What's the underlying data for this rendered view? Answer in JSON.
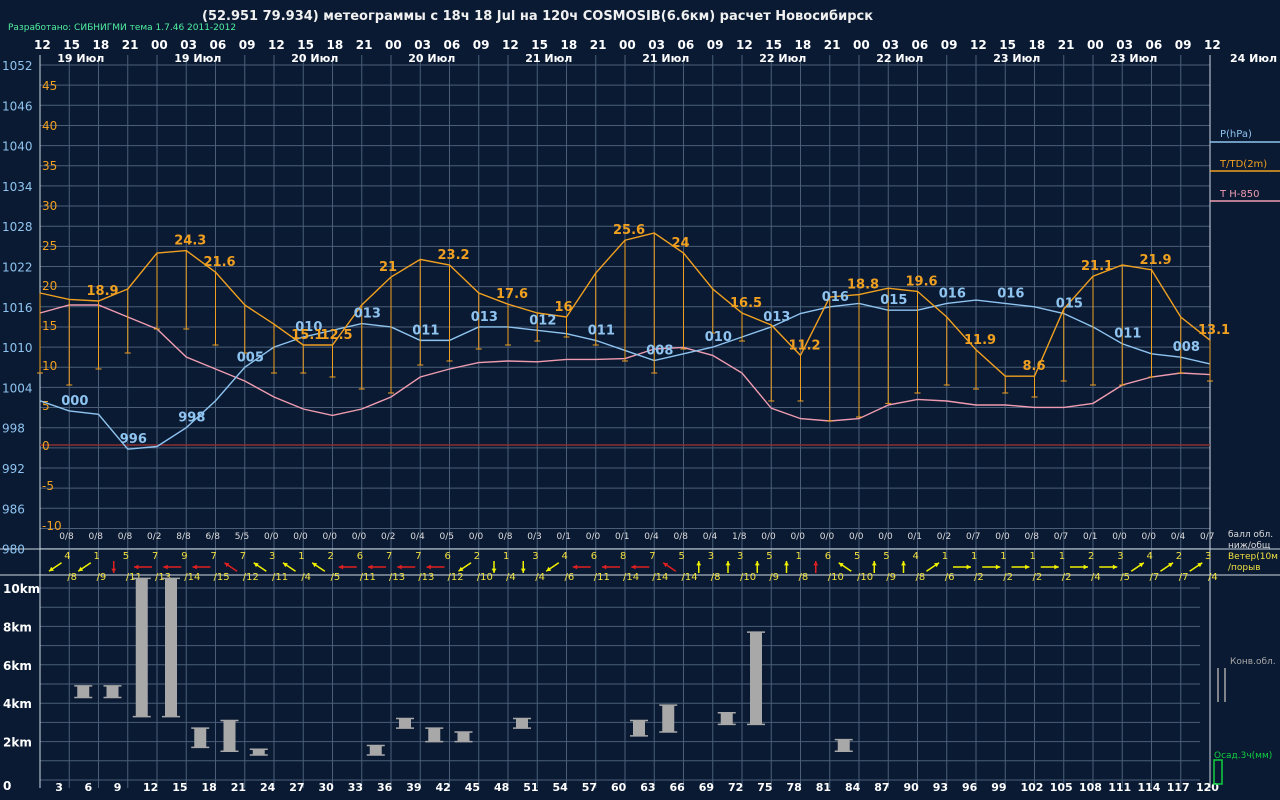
{
  "header": {
    "title": "(52.951 79.934) метеограммы с  18ч 18 Jul на 120ч COSMOSIB(6.6км) расчет Новосибирск",
    "credit": "Разработано: СИБНИГМИ тема 1.7.46 2011-2012"
  },
  "colors": {
    "bg": "#0a1a33",
    "grid": "#4a5e78",
    "white": "#ffffff",
    "pressure": "#8fc4f0",
    "temp": "#f0a020",
    "t850": "#ef9cb0",
    "zero": "#8a3030",
    "wind_yellow": "#f0f000",
    "wind_red": "#e02020",
    "cloud": "#a8a8a8",
    "precip": "#10d040",
    "label_yellow": "#f0e040"
  },
  "top_hours": [
    "12",
    "15",
    "18",
    "21",
    "00",
    "03",
    "06",
    "09",
    "12",
    "15",
    "18",
    "21",
    "00",
    "03",
    "06",
    "09",
    "12",
    "15",
    "18",
    "21",
    "00",
    "03",
    "06",
    "09",
    "12",
    "15",
    "18",
    "21",
    "00",
    "03",
    "06",
    "09",
    "12",
    "15",
    "18",
    "21",
    "00",
    "03",
    "06",
    "09",
    "12"
  ],
  "date_labels": [
    {
      "text": "19 Июл",
      "slot": 1
    },
    {
      "text": "19 Июл",
      "slot": 5
    },
    {
      "text": "20 Июл",
      "slot": 9
    },
    {
      "text": "20 Июл",
      "slot": 13
    },
    {
      "text": "21 Июл",
      "slot": 17
    },
    {
      "text": "21 Июл",
      "slot": 21
    },
    {
      "text": "22 Июл",
      "slot": 25
    },
    {
      "text": "22 Июл",
      "slot": 29
    },
    {
      "text": "23 Июл",
      "slot": 33
    },
    {
      "text": "23 Июл",
      "slot": 37
    },
    {
      "text": "24 Июл",
      "slot": 41
    }
  ],
  "pressure_ticks": [
    "1052",
    "1046",
    "1040",
    "1034",
    "1028",
    "1022",
    "1016",
    "1010",
    "1004",
    "998",
    "992",
    "986",
    "980"
  ],
  "temp_ticks": [
    "45",
    "40",
    "35",
    "30",
    "25",
    "20",
    "15",
    "10",
    "5",
    "0",
    "-5",
    "-10"
  ],
  "legend": {
    "pressure": "P(hPa)",
    "temp": "T/TD(2m)",
    "t850": "T H-850"
  },
  "cloud_label_1": "балл обл.",
  "cloud_label_2": "ниж/общ",
  "wind_label_1": "Ветер(10м",
  "wind_label_2": "/порыв",
  "alt_ticks": [
    "10km",
    "8km",
    "6km",
    "4km",
    "2km",
    "0"
  ],
  "bottom_hours": [
    "3",
    "6",
    "9",
    "12",
    "15",
    "18",
    "21",
    "24",
    "27",
    "30",
    "33",
    "36",
    "39",
    "42",
    "45",
    "48",
    "51",
    "54",
    "57",
    "60",
    "63",
    "66",
    "69",
    "72",
    "75",
    "78",
    "81",
    "84",
    "87",
    "90",
    "93",
    "96",
    "99",
    "102",
    "105",
    "108",
    "111",
    "114",
    "117",
    "120"
  ],
  "conv_label": "Конв.обл.",
  "precip_label": "Осад.3ч(мм)",
  "cloud_fractions": [
    "0/8",
    "0/8",
    "0/8",
    "0/2",
    "8/8",
    "6/8",
    "5/5",
    "0/0",
    "0/0",
    "0/0",
    "0/0",
    "0/2",
    "0/4",
    "0/5",
    "0/0",
    "0/8",
    "0/3",
    "0/1",
    "0/0",
    "0/1",
    "0/4",
    "0/8",
    "0/4",
    "1/8",
    "0/0",
    "0/0",
    "0/0",
    "0/0",
    "0/0",
    "0/1",
    "0/2",
    "0/7",
    "0/0",
    "0/8",
    "0/7",
    "0/1",
    "0/0",
    "0/0",
    "0/4",
    "0/7"
  ],
  "wind": [
    {
      "s": "4",
      "g": "/8",
      "d": "sw",
      "r": false
    },
    {
      "s": "1",
      "g": "/9",
      "d": "sw",
      "r": false
    },
    {
      "s": "5",
      "g": "/11",
      "d": "s",
      "r": true
    },
    {
      "s": "7",
      "g": "/13",
      "d": "w",
      "r": true
    },
    {
      "s": "9",
      "g": "/14",
      "d": "w",
      "r": true
    },
    {
      "s": "7",
      "g": "/15",
      "d": "w",
      "r": true
    },
    {
      "s": "7",
      "g": "/12",
      "d": "nw",
      "r": true
    },
    {
      "s": "3",
      "g": "/11",
      "d": "nw",
      "r": false
    },
    {
      "s": "1",
      "g": "/4",
      "d": "nw",
      "r": false
    },
    {
      "s": "2",
      "g": "/5",
      "d": "nw",
      "r": false
    },
    {
      "s": "6",
      "g": "/11",
      "d": "w",
      "r": true
    },
    {
      "s": "7",
      "g": "/13",
      "d": "w",
      "r": true
    },
    {
      "s": "7",
      "g": "/13",
      "d": "w",
      "r": true
    },
    {
      "s": "6",
      "g": "/12",
      "d": "w",
      "r": true
    },
    {
      "s": "2",
      "g": "/10",
      "d": "sw",
      "r": false
    },
    {
      "s": "1",
      "g": "/4",
      "d": "s",
      "r": false
    },
    {
      "s": "3",
      "g": "/4",
      "d": "s",
      "r": false
    },
    {
      "s": "4",
      "g": "/6",
      "d": "sw",
      "r": false
    },
    {
      "s": "6",
      "g": "/11",
      "d": "w",
      "r": true
    },
    {
      "s": "8",
      "g": "/14",
      "d": "w",
      "r": true
    },
    {
      "s": "7",
      "g": "/14",
      "d": "w",
      "r": true
    },
    {
      "s": "5",
      "g": "/14",
      "d": "nw",
      "r": true
    },
    {
      "s": "3",
      "g": "/8",
      "d": "n",
      "r": false
    },
    {
      "s": "3",
      "g": "/10",
      "d": "n",
      "r": false
    },
    {
      "s": "5",
      "g": "/9",
      "d": "n",
      "r": false
    },
    {
      "s": "1",
      "g": "/8",
      "d": "n",
      "r": false
    },
    {
      "s": "6",
      "g": "/10",
      "d": "n",
      "r": true
    },
    {
      "s": "5",
      "g": "/10",
      "d": "nw",
      "r": false
    },
    {
      "s": "5",
      "g": "/9",
      "d": "n",
      "r": false
    },
    {
      "s": "4",
      "g": "/8",
      "d": "n",
      "r": false
    },
    {
      "s": "1",
      "g": "/6",
      "d": "ne",
      "r": false
    },
    {
      "s": "1",
      "g": "/2",
      "d": "e",
      "r": false
    },
    {
      "s": "1",
      "g": "/2",
      "d": "e",
      "r": false
    },
    {
      "s": "1",
      "g": "/2",
      "d": "e",
      "r": false
    },
    {
      "s": "1",
      "g": "/2",
      "d": "e",
      "r": false
    },
    {
      "s": "2",
      "g": "/4",
      "d": "e",
      "r": false
    },
    {
      "s": "3",
      "g": "/5",
      "d": "e",
      "r": false
    },
    {
      "s": "4",
      "g": "/7",
      "d": "ne",
      "r": false
    },
    {
      "s": "2",
      "g": "/7",
      "d": "ne",
      "r": false
    },
    {
      "s": "3",
      "g": "/4",
      "d": "ne",
      "r": false
    }
  ],
  "chart_data": {
    "type": "line",
    "x_hours": [
      0,
      3,
      6,
      9,
      12,
      15,
      18,
      21,
      24,
      27,
      30,
      33,
      36,
      39,
      42,
      45,
      48,
      51,
      54,
      57,
      60,
      63,
      66,
      69,
      72,
      75,
      78,
      81,
      84,
      87,
      90,
      93,
      96,
      99,
      102,
      105,
      108,
      111,
      114,
      117,
      120
    ],
    "pressure_hpa": [
      1002,
      1000.5,
      1000,
      994.8,
      995.2,
      998,
      1002,
      1007,
      1010,
      1011.5,
      1012.5,
      1013.5,
      1013,
      1011,
      1011,
      1013,
      1013,
      1012.5,
      1012,
      1011,
      1009.5,
      1008,
      1009,
      1010,
      1011.5,
      1013,
      1015,
      1016,
      1016.5,
      1015.5,
      1015.5,
      1016.5,
      1017,
      1016.5,
      1016,
      1015,
      1013,
      1010.5,
      1009,
      1008.5,
      1007.5
    ],
    "pressure_labels": [
      {
        "i": 1,
        "t": "000"
      },
      {
        "i": 3,
        "t": "996"
      },
      {
        "i": 5,
        "t": "998"
      },
      {
        "i": 7,
        "t": "005"
      },
      {
        "i": 9,
        "t": "010"
      },
      {
        "i": 11,
        "t": "013"
      },
      {
        "i": 13,
        "t": "011"
      },
      {
        "i": 15,
        "t": "013"
      },
      {
        "i": 17,
        "t": "012"
      },
      {
        "i": 19,
        "t": "011"
      },
      {
        "i": 21,
        "t": "008"
      },
      {
        "i": 23,
        "t": "010"
      },
      {
        "i": 25,
        "t": "013"
      },
      {
        "i": 27,
        "t": "016"
      },
      {
        "i": 29,
        "t": "015"
      },
      {
        "i": 31,
        "t": "016"
      },
      {
        "i": 33,
        "t": "016"
      },
      {
        "i": 35,
        "t": "015"
      },
      {
        "i": 37,
        "t": "011"
      },
      {
        "i": 39,
        "t": "008"
      }
    ],
    "temp_c": [
      19,
      18.2,
      18,
      19.5,
      24,
      24.3,
      21.6,
      17.5,
      15.1,
      12.5,
      12.5,
      17.5,
      21,
      23.2,
      22.5,
      19,
      17.6,
      16.5,
      16,
      21.5,
      25.6,
      26.5,
      24,
      19.5,
      16.5,
      15,
      11.2,
      18.5,
      18.8,
      19.6,
      19.2,
      16,
      11.9,
      8.6,
      8.6,
      17,
      21.1,
      22.5,
      21.9,
      16,
      13.1
    ],
    "dewpoint_c": [
      9,
      7.5,
      9.5,
      11.5,
      14.5,
      14.5,
      12.5,
      11.5,
      9,
      9,
      8.5,
      7,
      6.5,
      10,
      10.5,
      12,
      12.5,
      13,
      13.5,
      12.5,
      10.5,
      9,
      12,
      14,
      13,
      5.5,
      5.5,
      3,
      3.5,
      5.2,
      6.5,
      7.5,
      7,
      6.5,
      6,
      8,
      7.5,
      7.5,
      8.5,
      9,
      8
    ],
    "temp_labels": [
      {
        "i": 2,
        "t": "18.9"
      },
      {
        "i": 5,
        "t": "24.3"
      },
      {
        "i": 6,
        "t": "21.6"
      },
      {
        "i": 9,
        "t": "15.1"
      },
      {
        "i": 10,
        "t": "12.5"
      },
      {
        "i": 12,
        "t": "21"
      },
      {
        "i": 14,
        "t": "23.2"
      },
      {
        "i": 16,
        "t": "17.6"
      },
      {
        "i": 18,
        "t": "16"
      },
      {
        "i": 20,
        "t": "25.6"
      },
      {
        "i": 22,
        "t": "24"
      },
      {
        "i": 24,
        "t": "16.5"
      },
      {
        "i": 26,
        "t": "11.2"
      },
      {
        "i": 28,
        "t": "18.8"
      },
      {
        "i": 30,
        "t": "19.6"
      },
      {
        "i": 32,
        "t": "11.9"
      },
      {
        "i": 34,
        "t": "8.6"
      },
      {
        "i": 36,
        "t": "21.1"
      },
      {
        "i": 38,
        "t": "21.9"
      },
      {
        "i": 40,
        "t": "13.1"
      }
    ],
    "t850_c": [
      16.5,
      17.5,
      17.5,
      16,
      14.5,
      11,
      9.5,
      8,
      6,
      4.5,
      3.7,
      4.5,
      6,
      8.5,
      9.5,
      10.3,
      10.5,
      10.4,
      10.7,
      10.7,
      10.8,
      12,
      12.2,
      11.2,
      9,
      4.6,
      3.3,
      3,
      3.3,
      5,
      5.7,
      5.5,
      5,
      5,
      4.7,
      4.7,
      5.2,
      7.5,
      8.5,
      9,
      8.8
    ],
    "cloud_km": [
      null,
      [
        4.3,
        4.9
      ],
      [
        4.3,
        4.9
      ],
      [
        3.3,
        10.5
      ],
      [
        3.3,
        10.5
      ],
      [
        1.7,
        2.7
      ],
      [
        1.5,
        3.1
      ],
      [
        1.3,
        1.6
      ],
      null,
      null,
      null,
      [
        1.3,
        1.8
      ],
      [
        2.7,
        3.2
      ],
      [
        2.0,
        2.7
      ],
      [
        2.0,
        2.5
      ],
      null,
      [
        2.7,
        3.2
      ],
      null,
      null,
      null,
      [
        2.3,
        3.1
      ],
      [
        2.5,
        3.9
      ],
      null,
      [
        2.9,
        3.5
      ],
      [
        2.9,
        7.7
      ],
      null,
      null,
      [
        1.5,
        2.1
      ],
      null,
      null,
      null,
      null,
      null,
      null,
      null,
      null,
      null,
      null,
      null,
      null,
      null
    ],
    "ylim_pressure": [
      980,
      1052
    ],
    "ylim_temp": [
      -10,
      45
    ],
    "ylim_alt_km": [
      0,
      11
    ]
  }
}
